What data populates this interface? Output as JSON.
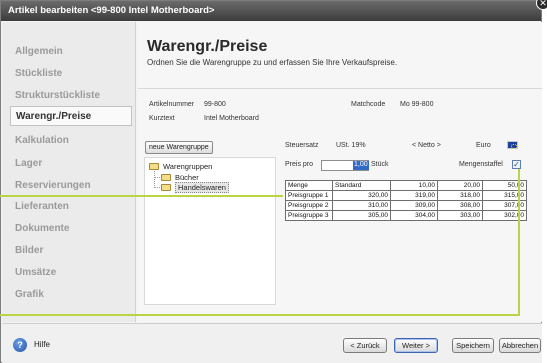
{
  "window": {
    "title": "Artikel bearbeiten <99-800 Intel Motherboard>",
    "close_glyph": "✕"
  },
  "sidebar": {
    "items": [
      {
        "label": "Allgemein"
      },
      {
        "label": "Stückliste"
      },
      {
        "label": "Strukturstückliste"
      },
      {
        "label": "Warengr./Preise",
        "active": true
      },
      {
        "label": "Kalkulation"
      },
      {
        "label": "Lager"
      },
      {
        "label": "Reservierungen"
      },
      {
        "label": "Lieferanten"
      },
      {
        "label": "Dokumente"
      },
      {
        "label": "Bilder"
      },
      {
        "label": "Umsätze"
      },
      {
        "label": "Grafik"
      }
    ]
  },
  "page": {
    "title": "Warengr./Preise",
    "subtitle": "Ordnen Sie die Warengruppe zu und erfassen Sie Ihre Verkaufspreise."
  },
  "article": {
    "nummer_label": "Artikelnummer",
    "nummer_value": "99-800",
    "matchcode_label": "Matchcode",
    "matchcode_value": "Mo 99-800",
    "kurztext_label": "Kurztext",
    "kurztext_value": "Intel Motherboard"
  },
  "warengruppen": {
    "new_button": "neue Warengruppe",
    "root": "Warengruppen",
    "children": [
      "Bücher",
      "Handelswaren"
    ],
    "selected": "Handelswaren"
  },
  "pricing": {
    "steuersatz_label": "Steuersatz",
    "steuersatz_value": "USt. 19%",
    "netto_label": "< Netto >",
    "currency": "Euro",
    "preis_pro_label": "Preis pro",
    "preis_pro_value": "1,00",
    "unit": "Stück",
    "mengenstaffel_label": "Mengenstaffel",
    "mengenstaffel_checked": true,
    "checkbox_glyph": "✓",
    "table": {
      "header": [
        "Menge",
        "Standard",
        "10,00",
        "20,00",
        "50,00"
      ],
      "rows": [
        [
          "Preisgruppe 1",
          "320,00",
          "319,00",
          "318,00",
          "315,00"
        ],
        [
          "Preisgruppe 2",
          "310,00",
          "309,00",
          "308,00",
          "307,00"
        ],
        [
          "Preisgruppe 3",
          "305,00",
          "304,00",
          "303,00",
          "302,00"
        ]
      ]
    }
  },
  "footer": {
    "help_label": "Hilfe",
    "help_glyph": "?",
    "back": "< Zurück",
    "next": "Weiter >",
    "save": "Speichern",
    "cancel": "Abbrechen"
  },
  "colors": {
    "callout": "#b9d445",
    "titlebar": "#4a4a4a",
    "selection": "#316ac5"
  }
}
